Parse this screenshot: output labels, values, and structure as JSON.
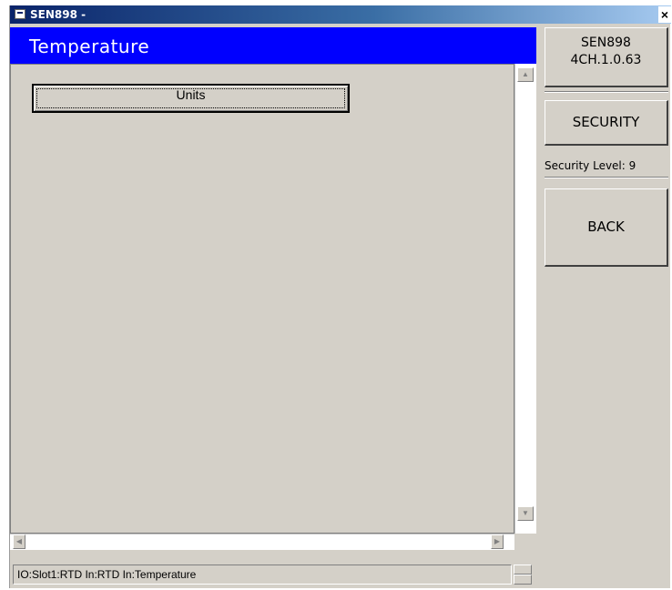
{
  "window": {
    "title": "SEN898 -",
    "close_glyph": "×"
  },
  "header": {
    "title": "Temperature"
  },
  "menu": {
    "items": [
      {
        "label": "Units"
      }
    ]
  },
  "sidebar": {
    "model": "SEN898",
    "version": "4CH.1.0.63",
    "security_button": "SECURITY",
    "security_level": "Security Level: 9",
    "back_button": "BACK"
  },
  "statusbar": {
    "path": "IO:Slot1:RTD In:RTD In:Temperature"
  },
  "icons": {
    "app": "app-window-icon",
    "close": "close-icon",
    "scroll_up": "arrow-up-icon",
    "scroll_down": "arrow-down-icon",
    "scroll_left": "arrow-left-icon",
    "scroll_right": "arrow-right-icon"
  },
  "colors": {
    "header_bg": "#0000ff",
    "window_bg": "#d4d0c8",
    "title_gradient_start": "#0a246a"
  }
}
